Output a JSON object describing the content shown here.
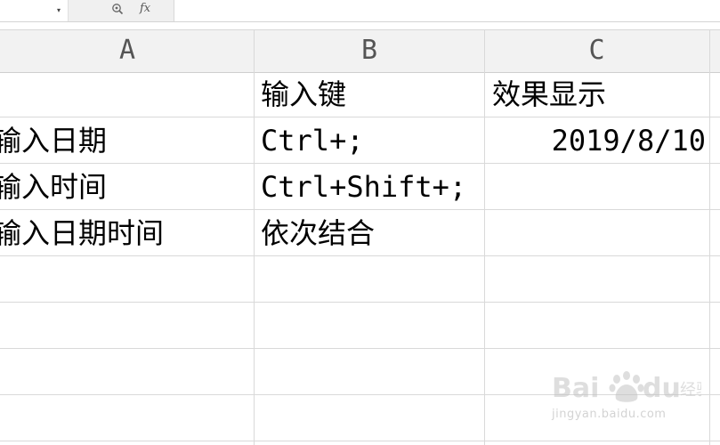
{
  "formula_bar": {
    "name_box_value": "",
    "fx_label": "fx",
    "formula_value": ""
  },
  "columns": [
    {
      "id": "A",
      "label": "A"
    },
    {
      "id": "B",
      "label": "B"
    },
    {
      "id": "C",
      "label": "C"
    }
  ],
  "rows": [
    {
      "a": "",
      "b": "输入键",
      "c": "效果显示"
    },
    {
      "a": "输入日期",
      "b": "Ctrl+;",
      "c": "2019/8/10"
    },
    {
      "a": "输入时间",
      "b": "Ctrl+Shift+;",
      "c": ""
    },
    {
      "a": "输入日期时间",
      "b": "依次结合",
      "c": ""
    },
    {
      "a": "",
      "b": "",
      "c": ""
    },
    {
      "a": "",
      "b": "",
      "c": ""
    },
    {
      "a": "",
      "b": "",
      "c": ""
    },
    {
      "a": "",
      "b": "",
      "c": ""
    }
  ],
  "watermark": {
    "text": "jingyan.baidu.com"
  },
  "colors": {
    "grid_line": "#d9d9d9",
    "header_bg": "#f2f2f2",
    "header_text": "#555555",
    "cell_text": "#000000"
  }
}
